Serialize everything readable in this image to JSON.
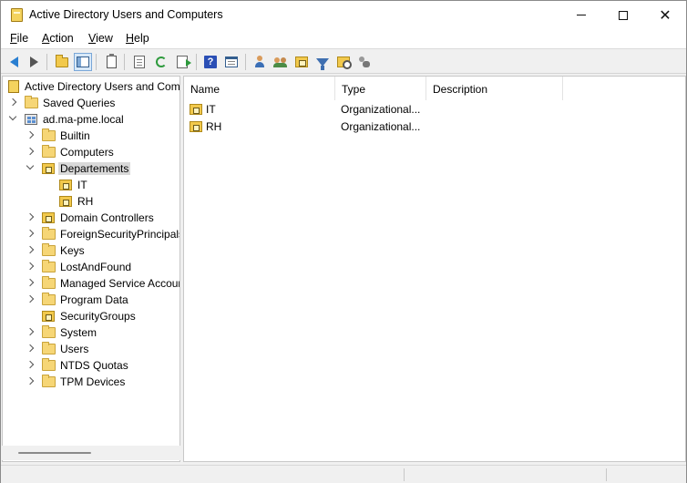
{
  "window": {
    "title": "Active Directory Users and Computers"
  },
  "menu": {
    "items": [
      "File",
      "Action",
      "View",
      "Help"
    ]
  },
  "toolbar": {
    "icons": [
      "back-arrow-icon",
      "forward-arrow-icon",
      "up-folder-icon",
      "show-hide-console-tree-icon",
      "clipboard-icon",
      "properties-icon",
      "refresh-icon",
      "export-list-icon",
      "help-icon",
      "show-hide-action-pane-icon",
      "new-user-icon",
      "new-group-icon",
      "new-ou-icon",
      "filter-icon",
      "find-icon",
      "delegate-control-icon"
    ]
  },
  "tree": {
    "root": "Active Directory Users and Com",
    "saved_queries": "Saved Queries",
    "domain": "ad.ma-pme.local",
    "children": [
      {
        "label": "Builtin",
        "type": "folder",
        "expander": "collapsed"
      },
      {
        "label": "Computers",
        "type": "folder",
        "expander": "collapsed"
      },
      {
        "label": "Departements",
        "type": "ou",
        "expander": "expanded",
        "selected": true
      },
      {
        "label": "IT",
        "type": "ou",
        "expander": "none",
        "indent": 2
      },
      {
        "label": "RH",
        "type": "ou",
        "expander": "none",
        "indent": 2
      },
      {
        "label": "Domain Controllers",
        "type": "ou",
        "expander": "collapsed"
      },
      {
        "label": "ForeignSecurityPrincipals",
        "type": "folder",
        "expander": "collapsed"
      },
      {
        "label": "Keys",
        "type": "folder",
        "expander": "collapsed"
      },
      {
        "label": "LostAndFound",
        "type": "folder",
        "expander": "collapsed"
      },
      {
        "label": "Managed Service Accour",
        "type": "folder",
        "expander": "collapsed"
      },
      {
        "label": "Program Data",
        "type": "folder",
        "expander": "collapsed"
      },
      {
        "label": "SecurityGroups",
        "type": "ou",
        "expander": "none"
      },
      {
        "label": "System",
        "type": "folder",
        "expander": "collapsed"
      },
      {
        "label": "Users",
        "type": "folder",
        "expander": "collapsed"
      },
      {
        "label": "NTDS Quotas",
        "type": "folder",
        "expander": "collapsed"
      },
      {
        "label": "TPM Devices",
        "type": "folder",
        "expander": "collapsed"
      }
    ]
  },
  "list": {
    "columns": [
      "Name",
      "Type",
      "Description"
    ],
    "rows": [
      {
        "name": "IT",
        "type": "Organizational...",
        "description": ""
      },
      {
        "name": "RH",
        "type": "Organizational...",
        "description": ""
      }
    ]
  }
}
